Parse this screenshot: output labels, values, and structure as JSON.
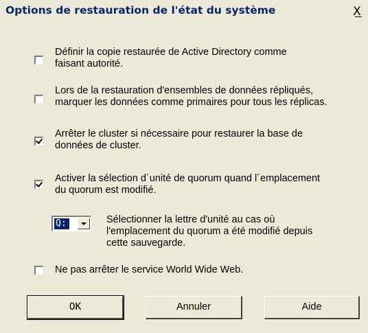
{
  "window": {
    "title": "Options de restauration de l'état du système",
    "close_glyph": "X"
  },
  "options": [
    {
      "label_lines": [
        "Définir la copie restaurée de Active Directory comme",
        "faisant autorité."
      ],
      "checked": false
    },
    {
      "label_lines": [
        "Lors de la restauration d'ensembles de données répliqués,",
        "marquer les données comme primaires pour tous les réplicas."
      ],
      "checked": false
    },
    {
      "label_lines": [
        "Arrêter le cluster si nécessaire pour restaurer la base de",
        "données de cluster."
      ],
      "checked": true
    },
    {
      "label_lines": [
        "Activer la sélection d´unité de quorum quand l´emplacement",
        "du quorum est modifié."
      ],
      "checked": true
    },
    {
      "label_lines": [
        "Ne pas arrêter le service World Wide Web."
      ],
      "checked": false
    }
  ],
  "drive_select": {
    "value": "Q:",
    "description_lines": [
      "Sélectionner la lettre d'unité au cas où",
      "l'emplacement du quorum a été modifié depuis",
      "cette sauvegarde."
    ]
  },
  "buttons": {
    "ok": "OK",
    "cancel": "Annuler",
    "help": "Aide"
  }
}
